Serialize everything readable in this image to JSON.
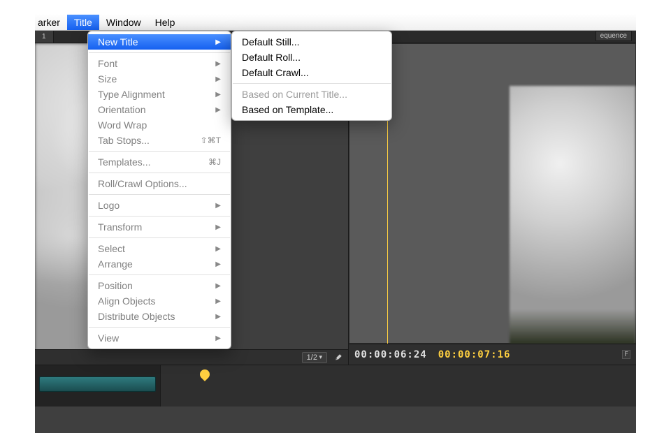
{
  "menubar": {
    "items": [
      {
        "label": "arker",
        "partial": true
      },
      {
        "label": "Title",
        "active": true
      },
      {
        "label": "Window"
      },
      {
        "label": "Help"
      }
    ]
  },
  "title_menu": {
    "groups": [
      [
        {
          "label": "New Title",
          "submenu": true,
          "highlight": true,
          "enabled": true
        }
      ],
      [
        {
          "label": "Font",
          "submenu": true
        },
        {
          "label": "Size",
          "submenu": true
        },
        {
          "label": "Type Alignment",
          "submenu": true
        },
        {
          "label": "Orientation",
          "submenu": true
        },
        {
          "label": "Word Wrap"
        },
        {
          "label": "Tab Stops...",
          "shortcut": "⇧⌘T"
        }
      ],
      [
        {
          "label": "Templates...",
          "shortcut": "⌘J"
        }
      ],
      [
        {
          "label": "Roll/Crawl Options..."
        }
      ],
      [
        {
          "label": "Logo",
          "submenu": true
        }
      ],
      [
        {
          "label": "Transform",
          "submenu": true
        }
      ],
      [
        {
          "label": "Select",
          "submenu": true
        },
        {
          "label": "Arrange",
          "submenu": true
        }
      ],
      [
        {
          "label": "Position",
          "submenu": true
        },
        {
          "label": "Align Objects",
          "submenu": true
        },
        {
          "label": "Distribute Objects",
          "submenu": true
        }
      ],
      [
        {
          "label": "View",
          "submenu": true
        }
      ]
    ]
  },
  "new_title_submenu": {
    "groups": [
      [
        {
          "label": "Default Still...",
          "enabled": true
        },
        {
          "label": "Default Roll...",
          "enabled": true
        },
        {
          "label": "Default Crawl...",
          "enabled": true
        }
      ],
      [
        {
          "label": "Based on Current Title...",
          "enabled": false
        },
        {
          "label": "Based on Template...",
          "enabled": true
        }
      ]
    ]
  },
  "workspace": {
    "tab_label": "1",
    "sequence_badge": "equence",
    "viewer": {
      "zoom_label": "1/2"
    },
    "timeline": {
      "current_tc": "00:00:06:24",
      "in_tc": "00:00:07:16",
      "fx_badge": "F"
    }
  }
}
